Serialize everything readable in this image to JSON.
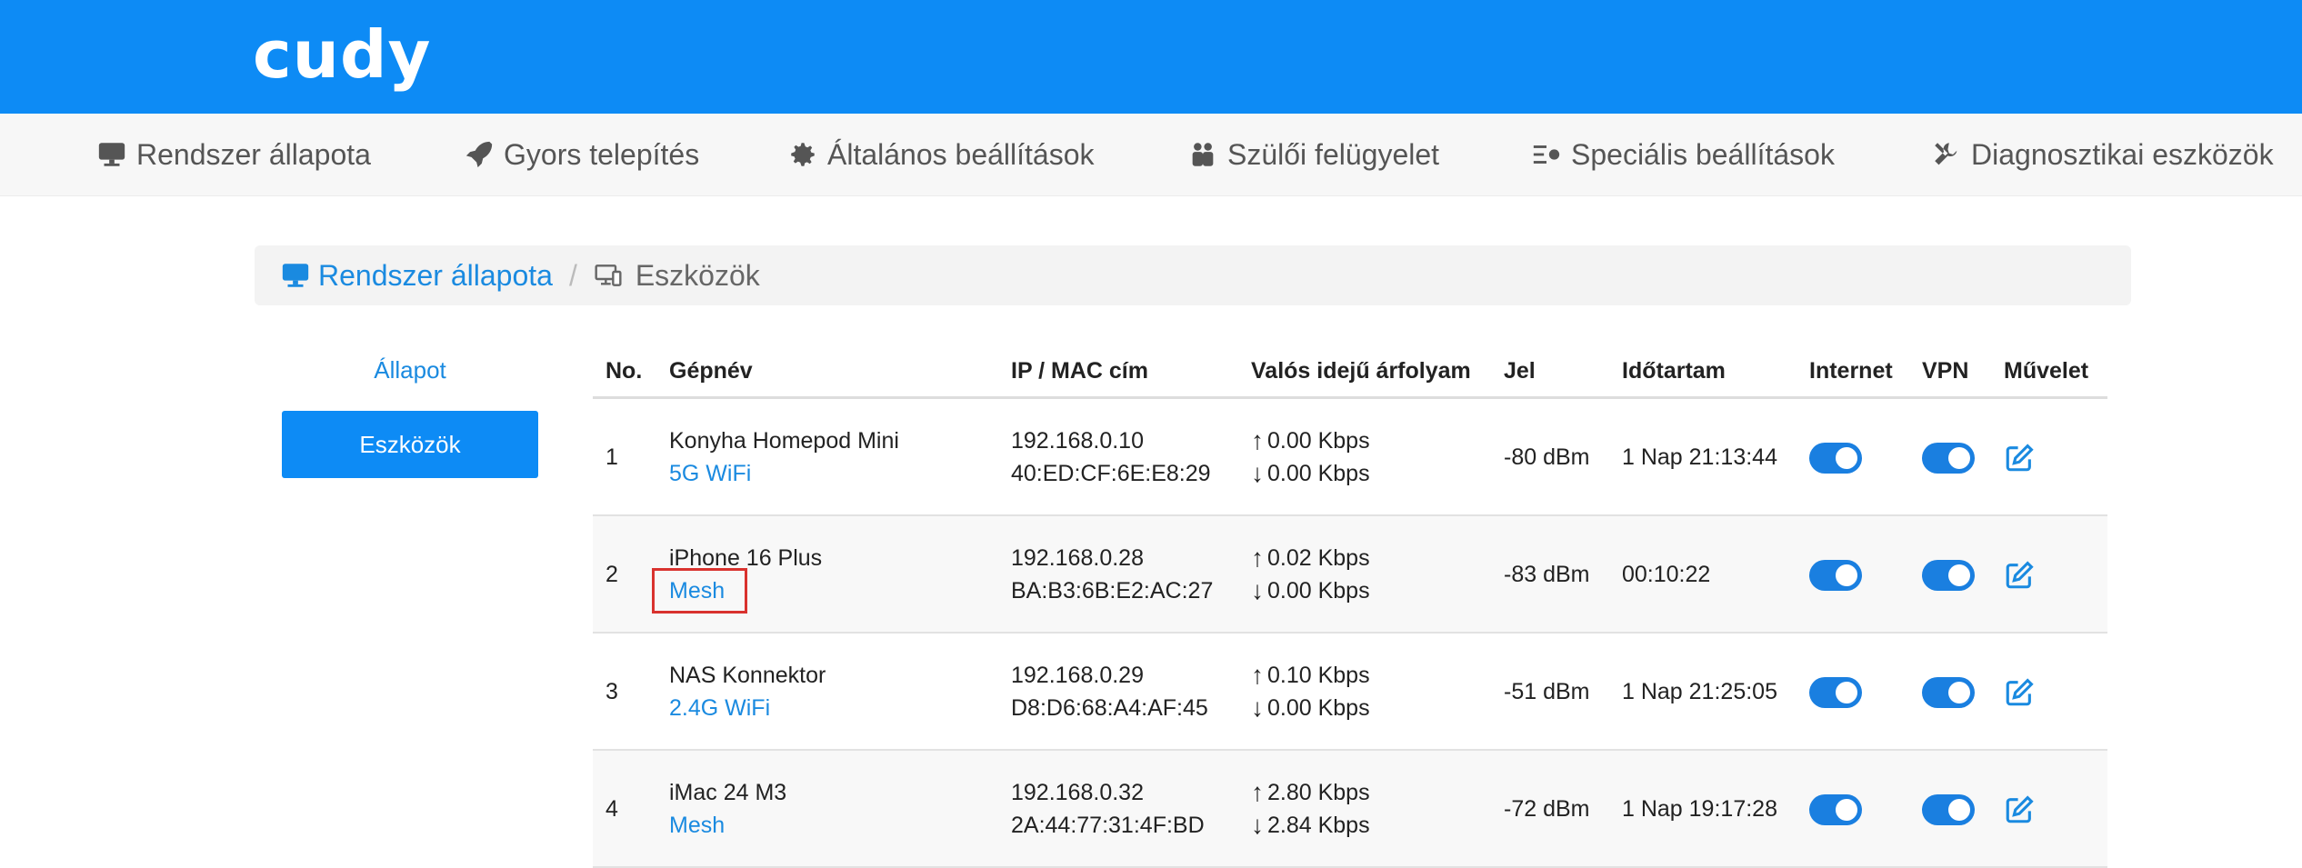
{
  "brand": {
    "logo_text": "cudy",
    "header_color": "#0d8bf5"
  },
  "nav": {
    "items": [
      {
        "label": "Rendszer állapota",
        "icon": "monitor-icon"
      },
      {
        "label": "Gyors telepítés",
        "icon": "rocket-icon"
      },
      {
        "label": "Általános beállítások",
        "icon": "gear-icon"
      },
      {
        "label": "Szülői felügyelet",
        "icon": "users-icon"
      },
      {
        "label": "Speciális beállítások",
        "icon": "advanced-settings-icon"
      },
      {
        "label": "Diagnosztikai eszközök",
        "icon": "tools-icon"
      }
    ]
  },
  "breadcrumb": {
    "home": "Rendszer állapota",
    "separator": "/",
    "current": "Eszközök"
  },
  "sidebar": {
    "items": [
      {
        "label": "Állapot"
      },
      {
        "label": "Eszközök"
      }
    ]
  },
  "table": {
    "headers": {
      "no": "No.",
      "name": "Gépnév",
      "ipmac": "IP / MAC cím",
      "rate": "Valós idejű árfolyam",
      "signal": "Jel",
      "duration": "Időtartam",
      "internet": "Internet",
      "vpn": "VPN",
      "action": "Művelet"
    },
    "rows": [
      {
        "no": "1",
        "name": "Konyha Homepod Mini",
        "conn": "5G WiFi",
        "ip": "192.168.0.10",
        "mac": "40:ED:CF:6E:E8:29",
        "up": "0.00 Kbps",
        "down": "0.00 Kbps",
        "signal": "-80 dBm",
        "duration": "1 Nap 21:13:44"
      },
      {
        "no": "2",
        "name": "iPhone 16 Plus",
        "conn": "Mesh",
        "ip": "192.168.0.28",
        "mac": "BA:B3:6B:E2:AC:27",
        "up": "0.02 Kbps",
        "down": "0.00 Kbps",
        "signal": "-83 dBm",
        "duration": "00:10:22"
      },
      {
        "no": "3",
        "name": "NAS Konnektor",
        "conn": "2.4G WiFi",
        "ip": "192.168.0.29",
        "mac": "D8:D6:68:A4:AF:45",
        "up": "0.10 Kbps",
        "down": "0.00 Kbps",
        "signal": "-51 dBm",
        "duration": "1 Nap 21:25:05"
      },
      {
        "no": "4",
        "name": "iMac 24 M3",
        "conn": "Mesh",
        "ip": "192.168.0.32",
        "mac": "2A:44:77:31:4F:BD",
        "up": "2.80 Kbps",
        "down": "2.84 Kbps",
        "signal": "-72 dBm",
        "duration": "1 Nap 19:17:28"
      }
    ],
    "arrows": {
      "up": "↑",
      "down": "↓"
    }
  }
}
